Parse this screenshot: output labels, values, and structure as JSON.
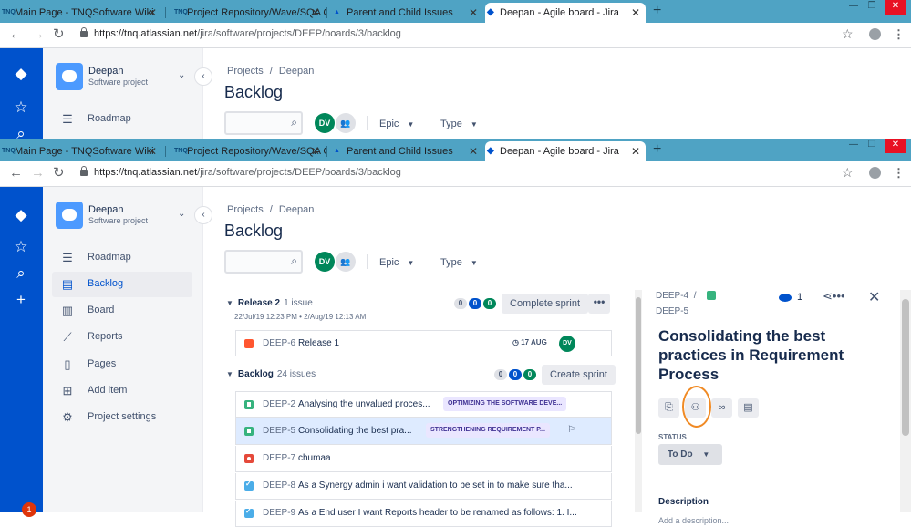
{
  "browser": {
    "tabs": [
      {
        "label": "Main Page - TNQSoftware Wiki",
        "icon": "tnq-icon"
      },
      {
        "label": "Project Repository/Wave/SQA Co",
        "icon": "tnq-icon"
      },
      {
        "label": "Parent and Child Issues",
        "icon": "atlassian-icon"
      },
      {
        "label": "Deepan - Agile board - Jira",
        "icon": "jira-icon"
      }
    ],
    "url_host": "https://tnq.atlassian.net",
    "url_path": "/jira/software/projects/DEEP/boards/3/backlog",
    "new_tab": "+"
  },
  "project": {
    "name": "Deepan",
    "type": "Software project"
  },
  "nav": [
    {
      "label": "Roadmap",
      "icon": "roadmap-icon",
      "glyph": "☰"
    },
    {
      "label": "Backlog",
      "icon": "backlog-icon",
      "glyph": "▤"
    },
    {
      "label": "Board",
      "icon": "board-icon",
      "glyph": "▥"
    },
    {
      "label": "Reports",
      "icon": "reports-icon",
      "glyph": "⟋"
    },
    {
      "label": "Pages",
      "icon": "pages-icon",
      "glyph": "▯"
    },
    {
      "label": "Add item",
      "icon": "add-item-icon",
      "glyph": "⊞"
    },
    {
      "label": "Project settings",
      "icon": "gear-icon",
      "glyph": "⚙"
    }
  ],
  "notification_count": "1",
  "breadcrumb": [
    "Projects",
    "/",
    "Deepan"
  ],
  "page_title": "Backlog",
  "toolbar": {
    "avatar_initials": "DV",
    "filters": [
      "Epic",
      "Type"
    ]
  },
  "release2": {
    "name": "Release 2",
    "count": "1 issue",
    "dates": "22/Jul/19 12:23 PM • 2/Aug/19 12:13 AM",
    "pills": [
      "0",
      "0",
      "0"
    ],
    "action": "Complete sprint",
    "more": "•••",
    "issues": [
      {
        "key": "DEEP-6",
        "summary": "Release 1",
        "type": "epic",
        "due": "◷ 17 AUG",
        "assignee": "DV"
      }
    ]
  },
  "backlog": {
    "name": "Backlog",
    "count": "24 issues",
    "pills": [
      "0",
      "0",
      "0"
    ],
    "action": "Create sprint",
    "issues": [
      {
        "key": "DEEP-2",
        "summary": "Analysing the unvalued proces...",
        "type": "story",
        "epic": "OPTIMIZING THE SOFTWARE DEVE..."
      },
      {
        "key": "DEEP-5",
        "summary": "Consolidating the best pra...",
        "type": "story",
        "epic": "STRENGTHENING REQUIREMENT P...",
        "selected": true
      },
      {
        "key": "DEEP-7",
        "summary": "chumaa",
        "type": "bug"
      },
      {
        "key": "DEEP-8",
        "summary": "As a Synergy admin i want validation to be set in to make sure tha...",
        "type": "task"
      },
      {
        "key": "DEEP-9",
        "summary": "As a End user I want Reports header to be renamed as follows: 1. I...",
        "type": "task"
      }
    ]
  },
  "detail": {
    "parent_key": "DEEP-4",
    "sep": "/",
    "key": "DEEP-5",
    "watchers": "1",
    "title": "Consolidating the best practices in Requirement Process",
    "status_label": "STATUS",
    "status": "To Do",
    "description_label": "Description",
    "description_placeholder": "Add a description..."
  },
  "colors": {
    "brand": "#0052cc",
    "tabstrip": "#4fa3c4",
    "highlight_circle": "#f08a24"
  }
}
